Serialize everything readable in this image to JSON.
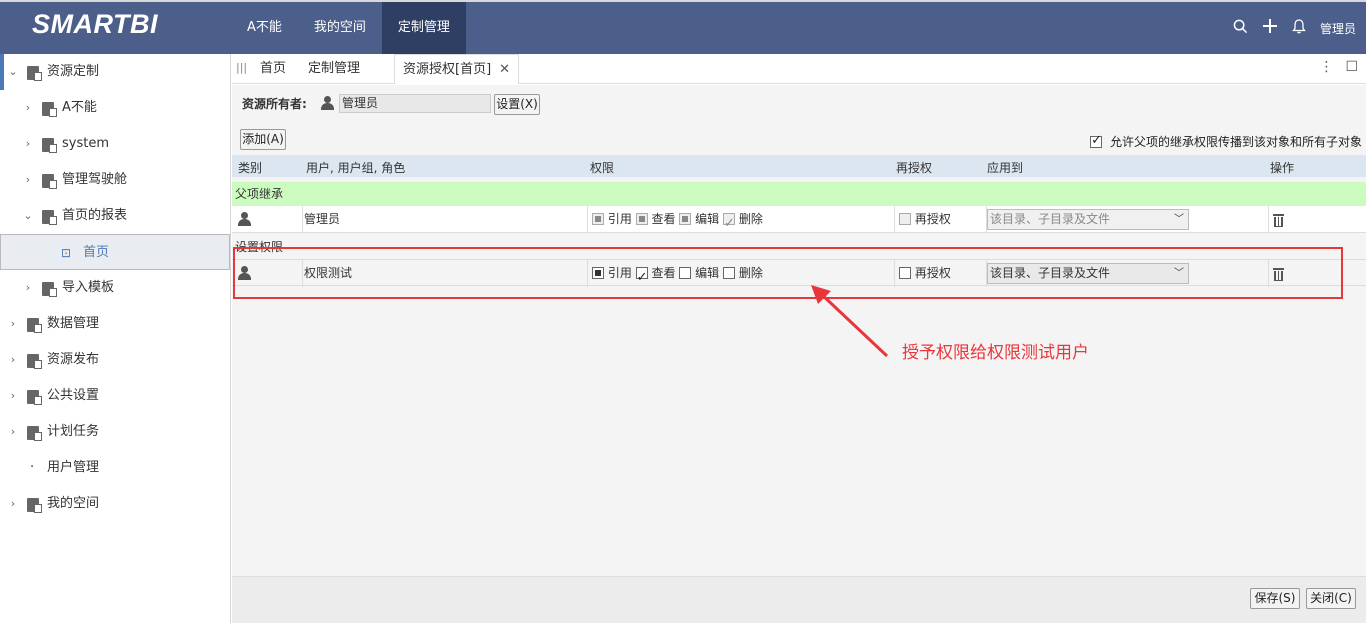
{
  "app": {
    "logo": "SMARTBI"
  },
  "topnav": {
    "items": [
      "A不能",
      "我的空间",
      "定制管理"
    ],
    "active_index": 2
  },
  "topright": {
    "search_icon": "search-icon",
    "add_icon": "plus-icon",
    "bell_icon": "bell-icon",
    "user": "管理员"
  },
  "sidebar": {
    "items": [
      {
        "label": "资源定制",
        "level": 0,
        "expanded": true
      },
      {
        "label": "A不能",
        "level": 1
      },
      {
        "label": "system",
        "level": 1
      },
      {
        "label": "管理驾驶舱",
        "level": 1
      },
      {
        "label": "首页的报表",
        "level": 1,
        "expanded": true
      },
      {
        "label": "首页",
        "level": 2,
        "selected": true
      },
      {
        "label": "导入模板",
        "level": 1
      },
      {
        "label": "数据管理",
        "level": 0
      },
      {
        "label": "资源发布",
        "level": 0
      },
      {
        "label": "公共设置",
        "level": 0
      },
      {
        "label": "计划任务",
        "level": 0
      },
      {
        "label": "用户管理",
        "level": 0
      },
      {
        "label": "我的空间",
        "level": 0
      }
    ]
  },
  "tabs": {
    "items": [
      "首页",
      "定制管理",
      "资源授权[首页]"
    ],
    "active_index": 2
  },
  "form": {
    "owner_label": "资源所有者:",
    "owner_value": "管理员",
    "set_button": "设置(X)",
    "add_button": "添加(A)",
    "propagate_label": "允许父项的继承权限传播到该对象和所有子对象",
    "propagate_checked": true
  },
  "table": {
    "headers": [
      "类别",
      "用户, 用户组, 角色",
      "权限",
      "再授权",
      "应用到",
      "操作"
    ],
    "group_inherit": "父项继承",
    "group_set": "设置权限",
    "inherit_row": {
      "name": "管理员",
      "perms": [
        "引用",
        "查看",
        "编辑",
        "删除"
      ],
      "regrant": "再授权",
      "apply_to": "该目录、子目录及文件"
    },
    "set_row": {
      "name": "权限测试",
      "perms": [
        "引用",
        "查看",
        "编辑",
        "删除"
      ],
      "regrant": "再授权",
      "apply_to": "该目录、子目录及文件"
    }
  },
  "annotation": "授予权限给权限测试用户",
  "footer": {
    "save": "保存(S)",
    "close": "关闭(C)"
  },
  "colors": {
    "topbar": "#4b5f8a",
    "accent": "#e8363b",
    "group_green": "#ccfbc0"
  }
}
